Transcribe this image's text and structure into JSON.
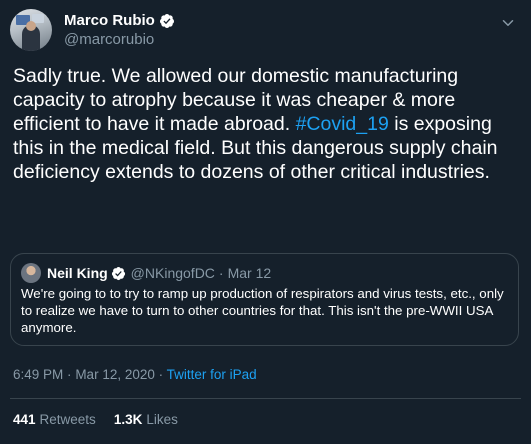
{
  "author": {
    "display_name": "Marco Rubio",
    "handle": "@marcorubio",
    "avatar_icon": "profile-photo"
  },
  "tweet": {
    "text_before": "Sadly true. We allowed our domestic manufacturing capacity to atrophy because it was cheaper & more efficient to have it made abroad. ",
    "hashtag": "#Covid_19",
    "text_after": " is exposing this in the medical field. But this dangerous supply chain deficiency extends to dozens of other critical industries."
  },
  "quoted": {
    "display_name": "Neil King",
    "handle": "@NKingofDC",
    "separator": "·",
    "date": "Mar 12",
    "text": "We're going to to try to ramp up production of respirators and virus tests, etc., only to realize we have to turn to other countries for that. This isn't the pre-WWII USA anymore."
  },
  "meta": {
    "time": "6:49 PM",
    "separator1": "·",
    "date": "Mar 12, 2020",
    "separator2": "·",
    "source": "Twitter for iPad"
  },
  "stats": {
    "retweets_count": "441",
    "retweets_label": "Retweets",
    "likes_count": "1.3K",
    "likes_label": "Likes"
  },
  "colors": {
    "background": "#15202b",
    "accent": "#1da1f2",
    "muted": "#8899a6",
    "border": "#38444d"
  },
  "icons": {
    "verified": "verified-badge-icon",
    "menu": "chevron-down-icon"
  }
}
